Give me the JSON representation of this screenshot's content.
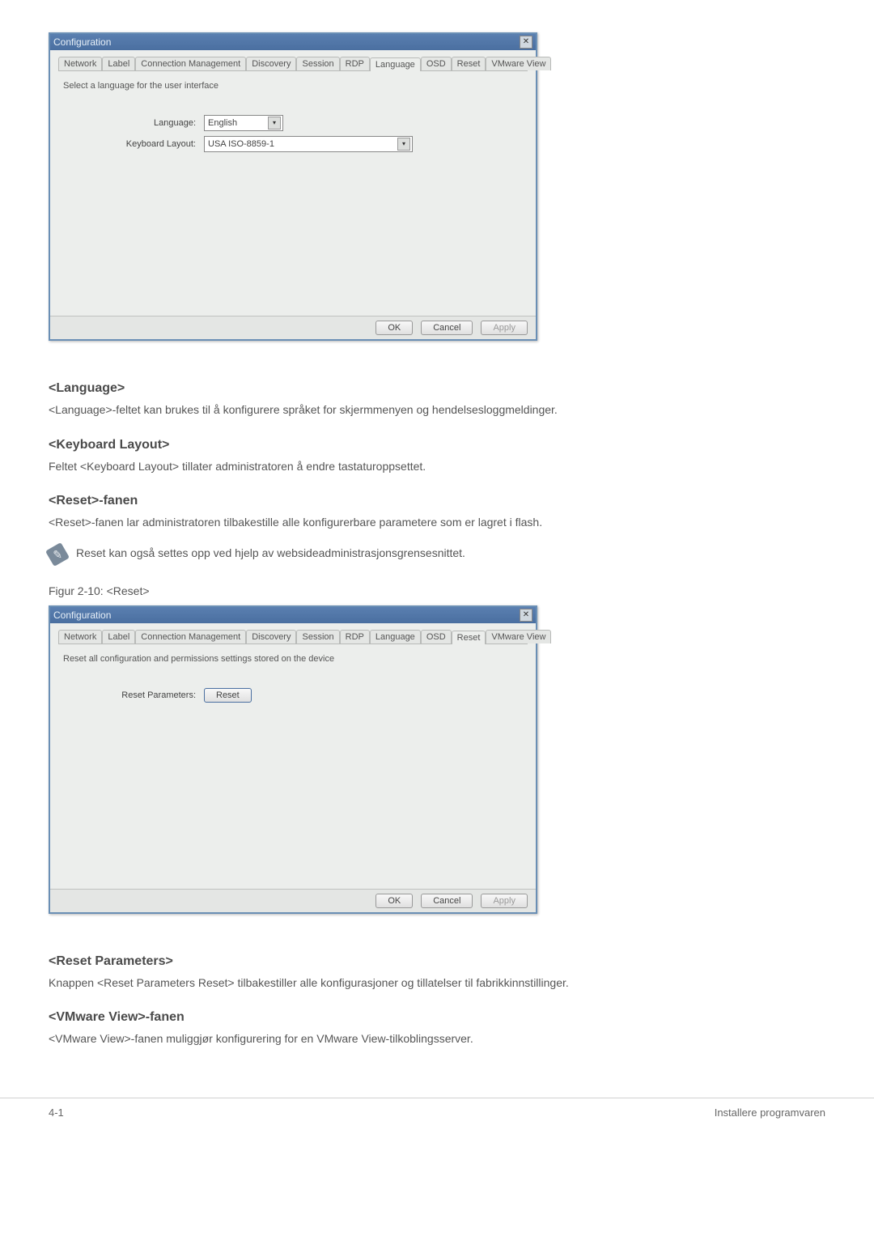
{
  "dialog1": {
    "title": "Configuration",
    "tabs": [
      "Network",
      "Label",
      "Connection Management",
      "Discovery",
      "Session",
      "RDP",
      "Language",
      "OSD",
      "Reset",
      "VMware View"
    ],
    "activeTab": "Language",
    "instruction": "Select a language for the user interface",
    "languageLabel": "Language:",
    "languageValue": "English",
    "keyboardLabel": "Keyboard Layout:",
    "keyboardValue": "USA ISO-8859-1",
    "ok": "OK",
    "cancel": "Cancel",
    "apply": "Apply"
  },
  "section_language": {
    "heading": "<Language>",
    "text": "<Language>-feltet kan brukes til å konfigurere språket for skjermmenyen og hendelsesloggmeldinger."
  },
  "section_keyboard": {
    "heading": "<Keyboard Layout>",
    "text": "Feltet <Keyboard Layout> tillater administratoren å endre tastaturoppsettet."
  },
  "section_reset_tab": {
    "heading": "<Reset>-fanen",
    "text": "<Reset>-fanen lar administratoren tilbakestille alle konfigurerbare parametere som er lagret i flash."
  },
  "note": "Reset kan også settes opp ved hjelp av websideadministrasjonsgrensesnittet.",
  "caption2": "Figur 2-10: <Reset>",
  "dialog2": {
    "title": "Configuration",
    "tabs": [
      "Network",
      "Label",
      "Connection Management",
      "Discovery",
      "Session",
      "RDP",
      "Language",
      "OSD",
      "Reset",
      "VMware View"
    ],
    "activeTab": "Reset",
    "instruction": "Reset all configuration and permissions settings stored on the device",
    "paramLabel": "Reset Parameters:",
    "resetBtn": "Reset",
    "ok": "OK",
    "cancel": "Cancel",
    "apply": "Apply"
  },
  "section_reset_params": {
    "heading": "<Reset Parameters>",
    "text": "Knappen <Reset Parameters Reset> tilbakestiller alle konfigurasjoner og tillatelser til fabrikkinnstillinger."
  },
  "section_vmware": {
    "heading": "<VMware View>-fanen",
    "text": "<VMware View>-fanen muliggjør konfigurering for en VMware View-tilkoblingsserver."
  },
  "footer": {
    "left": "4-1",
    "right": "Installere programvaren"
  }
}
